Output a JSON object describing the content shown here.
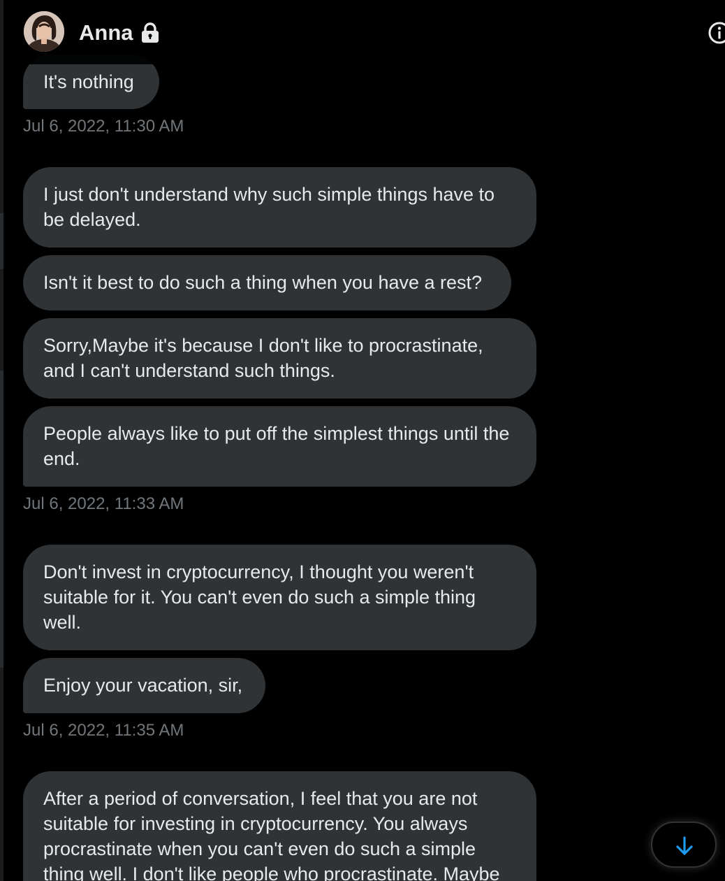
{
  "colors": {
    "background": "#000000",
    "bubble": "#2f3336",
    "text": "#e7e9ea",
    "muted": "#71767b",
    "accent": "#1d9bf0"
  },
  "header": {
    "name": "Anna",
    "avatar_icon": "user-avatar",
    "lock_icon": "lock-icon",
    "info_icon": "info-icon"
  },
  "messages": [
    {
      "text": "It's nothing"
    },
    {
      "timestamp": "Jul 6, 2022, 11:30 AM"
    },
    {
      "text": "I just don't understand why such simple things have to be delayed."
    },
    {
      "text": "Isn't it best to do such a thing when you have a rest?"
    },
    {
      "text": "Sorry,Maybe it's because I don't like to procrastinate, and I can't understand such things."
    },
    {
      "text": "People always like to put off the simplest things until the end."
    },
    {
      "timestamp": "Jul 6, 2022, 11:33 AM"
    },
    {
      "text": "Don't invest in cryptocurrency, I thought you weren't suitable for it. You can't even do such a simple thing well."
    },
    {
      "text": "Enjoy your vacation, sir,"
    },
    {
      "timestamp": "Jul 6, 2022, 11:35 AM"
    },
    {
      "text": "After a period of conversation, I feel that you are not suitable for investing in cryptocurrency. You always procrastinate when you can't even do such a simple thing well. I don't like people who procrastinate. Maybe"
    }
  ],
  "scroll_button": {
    "icon": "arrow-down-icon"
  }
}
